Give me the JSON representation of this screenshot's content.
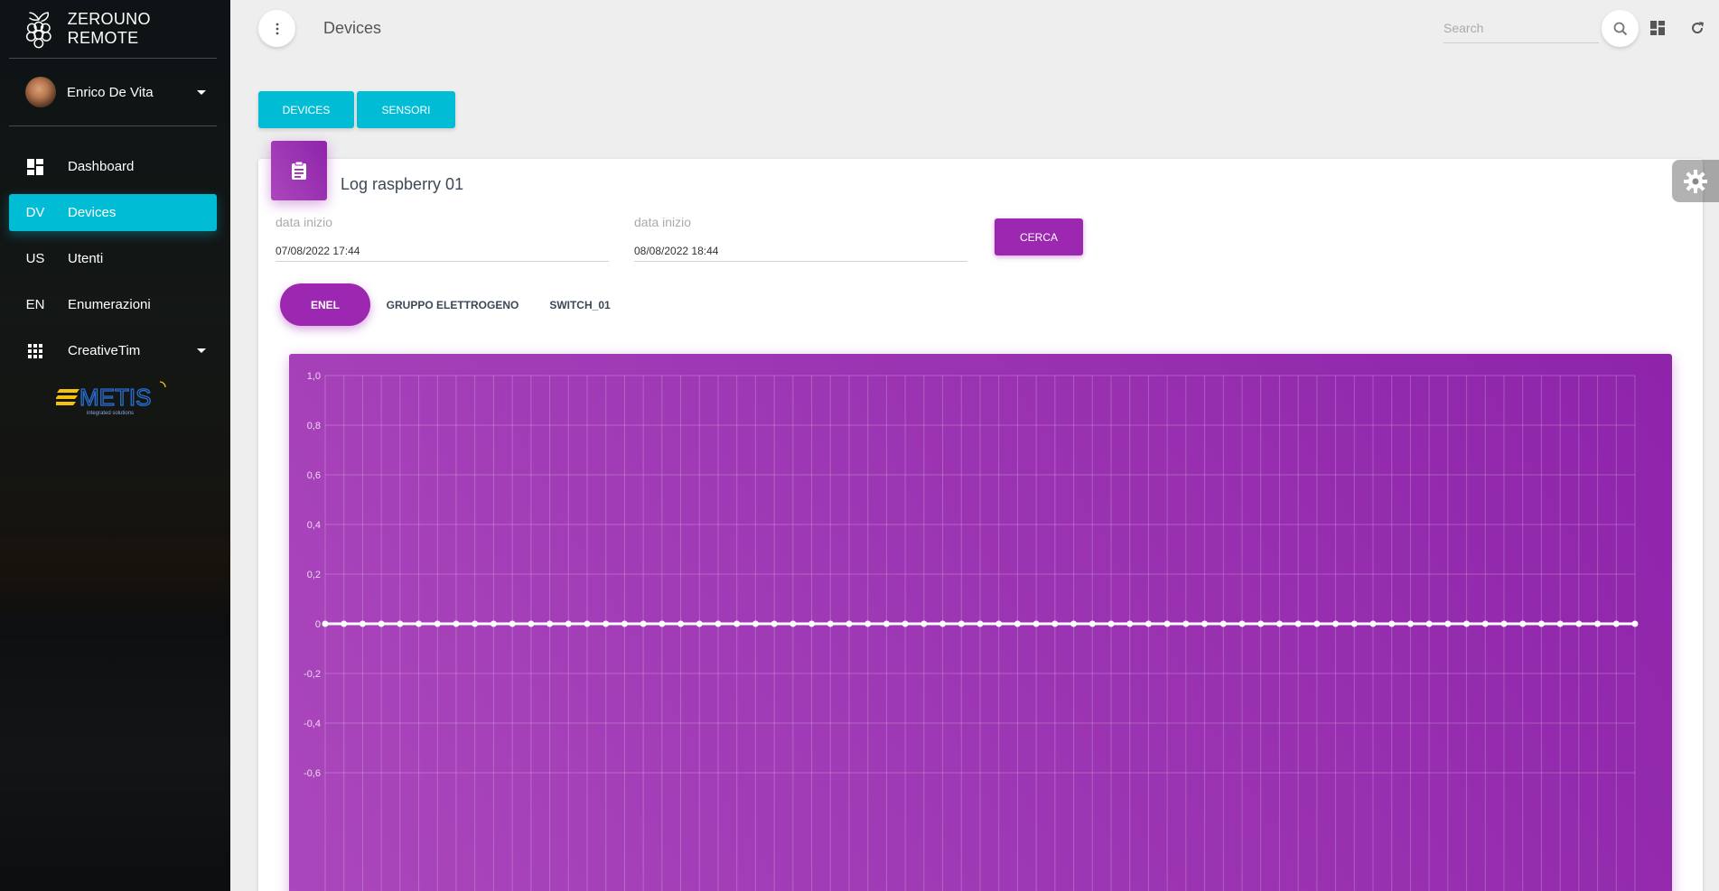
{
  "app": {
    "title": "ZEROUNO REMOTE"
  },
  "user": {
    "name": "Enrico De Vita"
  },
  "sidebar": {
    "items": [
      {
        "abbr": "",
        "label": "Dashboard",
        "icon": "dashboard-icon"
      },
      {
        "abbr": "DV",
        "label": "Devices"
      },
      {
        "abbr": "US",
        "label": "Utenti"
      },
      {
        "abbr": "EN",
        "label": "Enumerazioni"
      },
      {
        "abbr": "",
        "label": "CreativeTim",
        "icon": "apps-grid-icon"
      }
    ],
    "logo_text": "METIS",
    "logo_sub": "integrated solutions"
  },
  "header": {
    "title": "Devices",
    "search_placeholder": "Search"
  },
  "tabs": [
    {
      "label": "DEVICES"
    },
    {
      "label": "SENSORI"
    }
  ],
  "card": {
    "title": "Log raspberry 01",
    "start_label": "data inizio",
    "start_value": "07/08/2022 17:44",
    "end_label": "data inizio",
    "end_value": "08/08/2022 18:44",
    "search_button": "CERCA"
  },
  "pills": [
    {
      "label": "ENEL",
      "active": true
    },
    {
      "label": "GRUPPO ELETTROGENO",
      "active": false
    },
    {
      "label": "SWITCH_01",
      "active": false
    }
  ],
  "colors": {
    "accent": "#00bcd4",
    "primary": "#9c27b0"
  },
  "chart_data": {
    "type": "line",
    "x_count": 71,
    "values": [
      0,
      0,
      0,
      0,
      0,
      0,
      0,
      0,
      0,
      0,
      0,
      0,
      0,
      0,
      0,
      0,
      0,
      0,
      0,
      0,
      0,
      0,
      0,
      0,
      0,
      0,
      0,
      0,
      0,
      0,
      0,
      0,
      0,
      0,
      0,
      0,
      0,
      0,
      0,
      0,
      0,
      0,
      0,
      0,
      0,
      0,
      0,
      0,
      0,
      0,
      0,
      0,
      0,
      0,
      0,
      0,
      0,
      0,
      0,
      0,
      0,
      0,
      0,
      0,
      0,
      0,
      0,
      0,
      0,
      0,
      0
    ],
    "y_ticks": [
      "1,0",
      "0,8",
      "0,6",
      "0,4",
      "0,2",
      "0",
      "-0,2",
      "-0,4",
      "-0,6"
    ],
    "ylim": [
      -0.6,
      1.0
    ],
    "grid": true
  }
}
